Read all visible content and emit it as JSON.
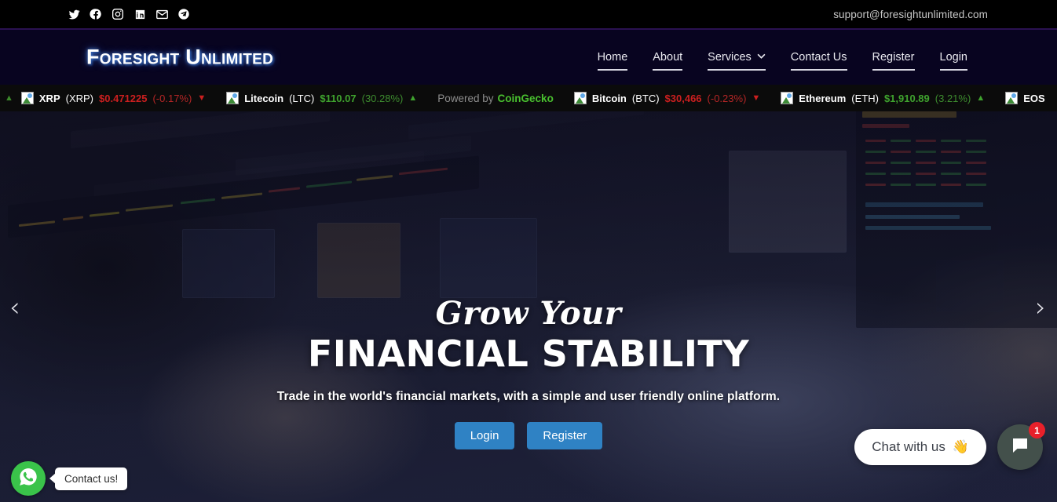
{
  "topbar": {
    "social": [
      {
        "name": "twitter-icon",
        "label": "Twitter"
      },
      {
        "name": "facebook-icon",
        "label": "Facebook"
      },
      {
        "name": "instagram-icon",
        "label": "Instagram"
      },
      {
        "name": "linkedin-icon",
        "label": "LinkedIn"
      },
      {
        "name": "email-icon",
        "label": "Email"
      },
      {
        "name": "telegram-icon",
        "label": "Telegram"
      }
    ],
    "email": "support@foresightunlimited.com"
  },
  "header": {
    "logo": "Foresight Unlimited",
    "nav": [
      {
        "label": "Home",
        "has_dropdown": false
      },
      {
        "label": "About",
        "has_dropdown": false
      },
      {
        "label": "Services",
        "has_dropdown": true,
        "chevron": "⌄"
      },
      {
        "label": "Contact Us",
        "has_dropdown": false
      },
      {
        "label": "Register",
        "has_dropdown": false
      },
      {
        "label": "Login",
        "has_dropdown": false
      }
    ]
  },
  "ticker": {
    "lead_caret": "▲",
    "powered_by_text": "Powered by",
    "powered_by_brand": "CoinGecko",
    "coins": [
      {
        "name": "XRP",
        "symbol": "(XRP)",
        "price": "$0.471225",
        "change": "(-0.17%)",
        "direction": "down",
        "caret": "▼"
      },
      {
        "name": "Litecoin",
        "symbol": "(LTC)",
        "price": "$110.07",
        "change": "(30.28%)",
        "direction": "up",
        "caret": "▲"
      },
      {
        "name": "Bitcoin",
        "symbol": "(BTC)",
        "price": "$30,466",
        "change": "(-0.23%)",
        "direction": "down",
        "caret": "▼"
      },
      {
        "name": "Ethereum",
        "symbol": "(ETH)",
        "price": "$1,910.89",
        "change": "(3.21%)",
        "direction": "up",
        "caret": "▲"
      },
      {
        "name": "EOS",
        "symbol": "",
        "price": "",
        "change": "",
        "direction": "up",
        "caret": ""
      }
    ]
  },
  "hero": {
    "script_line": "Grow Your",
    "title": "FINANCIAL STABILITY",
    "subtitle": "Trade in the world's financial markets, with a simple and user friendly online platform.",
    "buttons": [
      {
        "label": "Login"
      },
      {
        "label": "Register"
      }
    ],
    "prev_arrow": "‹",
    "next_arrow": "›"
  },
  "whatsapp": {
    "tooltip": "Contact us!"
  },
  "chat": {
    "pill_text": "Chat with us",
    "pill_emoji": "👋",
    "badge": "1"
  },
  "colors": {
    "accent_blue": "#2f82c4",
    "header_bg": "#080420",
    "ticker_up": "#3fa32e",
    "ticker_down": "#cc1f1f",
    "whatsapp_green": "#3ac34a",
    "badge_red": "#e8202a"
  }
}
